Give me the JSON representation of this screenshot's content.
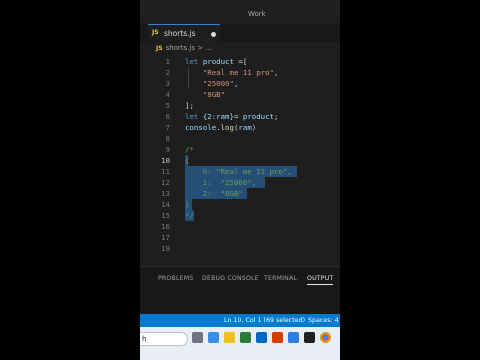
{
  "window": {
    "title": "Work"
  },
  "tab": {
    "badge": "JS",
    "name": "shorts.js"
  },
  "breadcrumb": {
    "badge": "JS",
    "file": "shorts.js",
    "sep": ">",
    "more": "..."
  },
  "editor": {
    "lines": [
      {
        "n": "1",
        "tokens": [
          {
            "t": "let ",
            "c": "kw"
          },
          {
            "t": "product ",
            "c": "id"
          },
          {
            "t": "=[",
            "c": "pl"
          }
        ]
      },
      {
        "n": "2",
        "tokens": [
          {
            "t": "    ",
            "c": "pl"
          },
          {
            "t": "\"Real me 11 pro\"",
            "c": "str"
          },
          {
            "t": ",",
            "c": "pl"
          }
        ]
      },
      {
        "n": "3",
        "tokens": [
          {
            "t": "    ",
            "c": "pl"
          },
          {
            "t": "\"25000\"",
            "c": "str"
          },
          {
            "t": ",",
            "c": "pl"
          }
        ]
      },
      {
        "n": "4",
        "tokens": [
          {
            "t": "    ",
            "c": "pl"
          },
          {
            "t": "\"8GB\"",
            "c": "str"
          }
        ]
      },
      {
        "n": "5",
        "tokens": [
          {
            "t": "];",
            "c": "pl"
          }
        ]
      },
      {
        "n": "6",
        "tokens": [
          {
            "t": "let ",
            "c": "kw"
          },
          {
            "t": "{2:ram}",
            "c": "id"
          },
          {
            "t": "= ",
            "c": "pl"
          },
          {
            "t": "product",
            "c": "id"
          },
          {
            "t": ";",
            "c": "pl"
          }
        ]
      },
      {
        "n": "7",
        "tokens": [
          {
            "t": "console",
            "c": "id"
          },
          {
            "t": ".",
            "c": "pl"
          },
          {
            "t": "log",
            "c": "fn"
          },
          {
            "t": "(",
            "c": "pl"
          },
          {
            "t": "ram",
            "c": "id"
          },
          {
            "t": ")",
            "c": "pl"
          }
        ]
      },
      {
        "n": "8",
        "tokens": []
      },
      {
        "n": "9",
        "tokens": [
          {
            "t": "/*",
            "c": "cm"
          }
        ]
      },
      {
        "n": "10",
        "tokens": [
          {
            "t": "{",
            "c": "cm"
          }
        ]
      },
      {
        "n": "11",
        "tokens": [
          {
            "t": "    0: \"Real me 11 pro\",",
            "c": "cm"
          }
        ]
      },
      {
        "n": "12",
        "tokens": [
          {
            "t": "    1:  \"25000\",",
            "c": "cm"
          }
        ]
      },
      {
        "n": "13",
        "tokens": [
          {
            "t": "    2:  \"8GB\"",
            "c": "cm"
          }
        ]
      },
      {
        "n": "14",
        "tokens": [
          {
            "t": "}",
            "c": "cm"
          }
        ]
      },
      {
        "n": "15",
        "tokens": [
          {
            "t": "*/",
            "c": "cm"
          }
        ]
      },
      {
        "n": "16",
        "tokens": []
      },
      {
        "n": "17",
        "tokens": []
      },
      {
        "n": "18",
        "tokens": []
      }
    ]
  },
  "panel": {
    "tabs": [
      {
        "label": "PROBLEMS",
        "active": false
      },
      {
        "label": "DEBUG CONSOLE",
        "active": false
      },
      {
        "label": "TERMINAL",
        "active": false
      },
      {
        "label": "OUTPUT",
        "active": true
      }
    ]
  },
  "status": {
    "position": "Ln 10, Col 1 (69 selected)",
    "spaces": "Spaces: 4"
  },
  "taskbar": {
    "search_text": "h"
  },
  "colors": {
    "accent": "#007acc",
    "selection": "#264f78",
    "comment": "#6a9955",
    "string": "#ce9178",
    "keyword": "#569cd6"
  }
}
